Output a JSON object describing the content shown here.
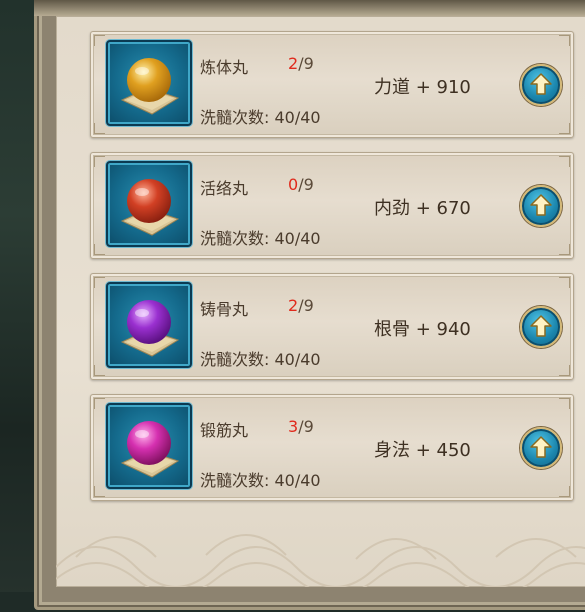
{
  "pills": [
    {
      "name": "炼体丸",
      "current": "2",
      "max": "/9",
      "wash_label": "洗髓次数: 40/40",
      "bonus": "力道 + 910",
      "color": "#e0a020",
      "highlight": "#fff3b0",
      "shade": "#a86a0a"
    },
    {
      "name": "活络丸",
      "current": "0",
      "max": "/9",
      "wash_label": "洗髓次数: 40/40",
      "bonus": "内劲 + 670",
      "color": "#d24024",
      "highlight": "#ffb49a",
      "shade": "#8a2010"
    },
    {
      "name": "铸骨丸",
      "current": "2",
      "max": "/9",
      "wash_label": "洗髓次数: 40/40",
      "bonus": "根骨 + 940",
      "color": "#9a30d0",
      "highlight": "#e6b0ff",
      "shade": "#5a1080"
    },
    {
      "name": "锻筋丸",
      "current": "3",
      "max": "/9",
      "wash_label": "洗髓次数: 40/40",
      "bonus": "身法 + 450",
      "color": "#d530b0",
      "highlight": "#ffb0ea",
      "shade": "#80105f"
    }
  ],
  "icons": {
    "upgrade": "up-arrow-icon",
    "pill": "pill-orb-icon"
  }
}
